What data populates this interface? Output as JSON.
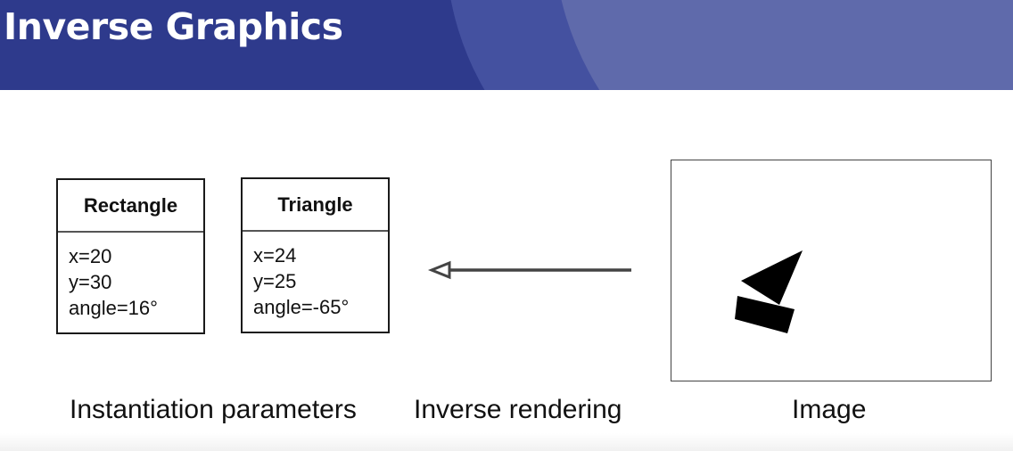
{
  "header": {
    "title": "Inverse Graphics",
    "colors": {
      "dark_band": "#2e3a8c",
      "mid_band": "#4451a0",
      "light_band": "#5f6aab"
    }
  },
  "boxes": [
    {
      "title": "Rectangle",
      "params": [
        "x=20",
        "y=30",
        "angle=16°"
      ]
    },
    {
      "title": "Triangle",
      "params": [
        "x=24",
        "y=25",
        "angle=-65°"
      ]
    }
  ],
  "captions": {
    "parameters": "Instantiation parameters",
    "rendering": "Inverse rendering",
    "image": "Image"
  },
  "arrow": {
    "direction": "left",
    "color": "#444444"
  },
  "image_shapes": {
    "fill": "#000000",
    "shapes": [
      "triangle",
      "rectangle"
    ]
  }
}
